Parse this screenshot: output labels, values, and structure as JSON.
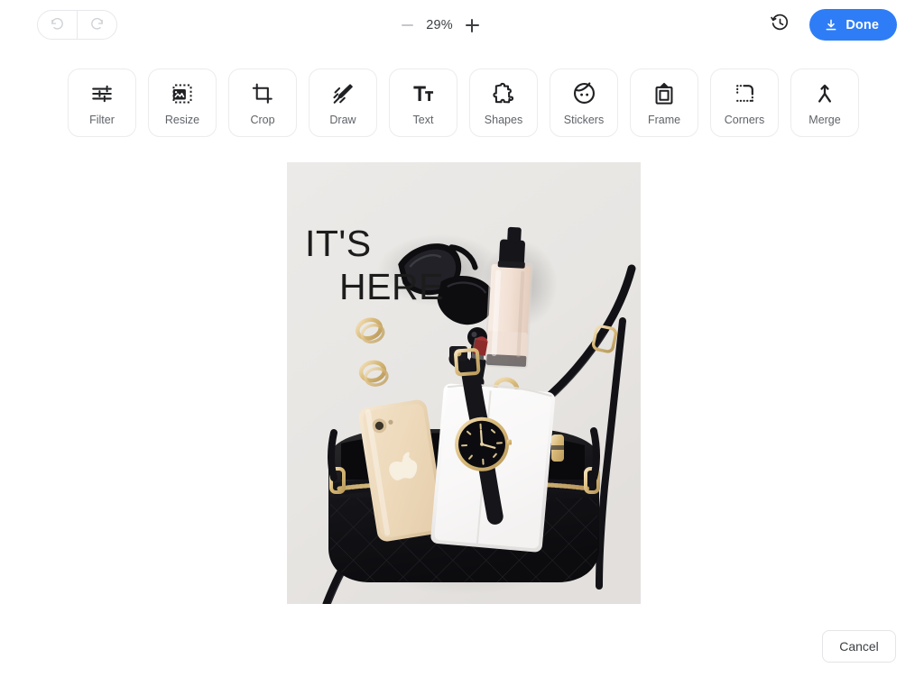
{
  "topbar": {
    "undo": {
      "label": "Undo",
      "icon": "undo-arrow-icon",
      "disabled": true
    },
    "redo": {
      "label": "Redo",
      "icon": "redo-arrow-icon",
      "disabled": true
    },
    "zoom": {
      "value": "29%",
      "minus_label": "−",
      "plus_label": "+",
      "minus_icon": "minus-icon",
      "plus_icon": "plus-icon"
    },
    "history": {
      "label": "History",
      "icon": "history-clock-icon"
    },
    "done": {
      "label": "Done",
      "icon": "download-icon",
      "color": "#2e7df6"
    }
  },
  "toolbar": {
    "tools": [
      {
        "label": "Filter",
        "icon": "sliders-icon"
      },
      {
        "label": "Resize",
        "icon": "resize-image-icon"
      },
      {
        "label": "Crop",
        "icon": "crop-icon"
      },
      {
        "label": "Draw",
        "icon": "pencil-draw-icon"
      },
      {
        "label": "Text",
        "icon": "text-tt-icon"
      },
      {
        "label": "Shapes",
        "icon": "puzzle-piece-icon"
      },
      {
        "label": "Stickers",
        "icon": "smiley-face-icon"
      },
      {
        "label": "Frame",
        "icon": "picture-frame-icon"
      },
      {
        "label": "Corners",
        "icon": "rounded-corner-icon"
      },
      {
        "label": "Merge",
        "icon": "merge-arrow-icon"
      }
    ]
  },
  "canvas": {
    "image_alt": "Flat lay photo of black quilted handbag with phone, watch, wallet, sunglasses, lipstick and foundation",
    "overlay": {
      "line1": "IT'S",
      "line2": "HERE"
    }
  },
  "footer": {
    "cancel": {
      "label": "Cancel"
    }
  }
}
